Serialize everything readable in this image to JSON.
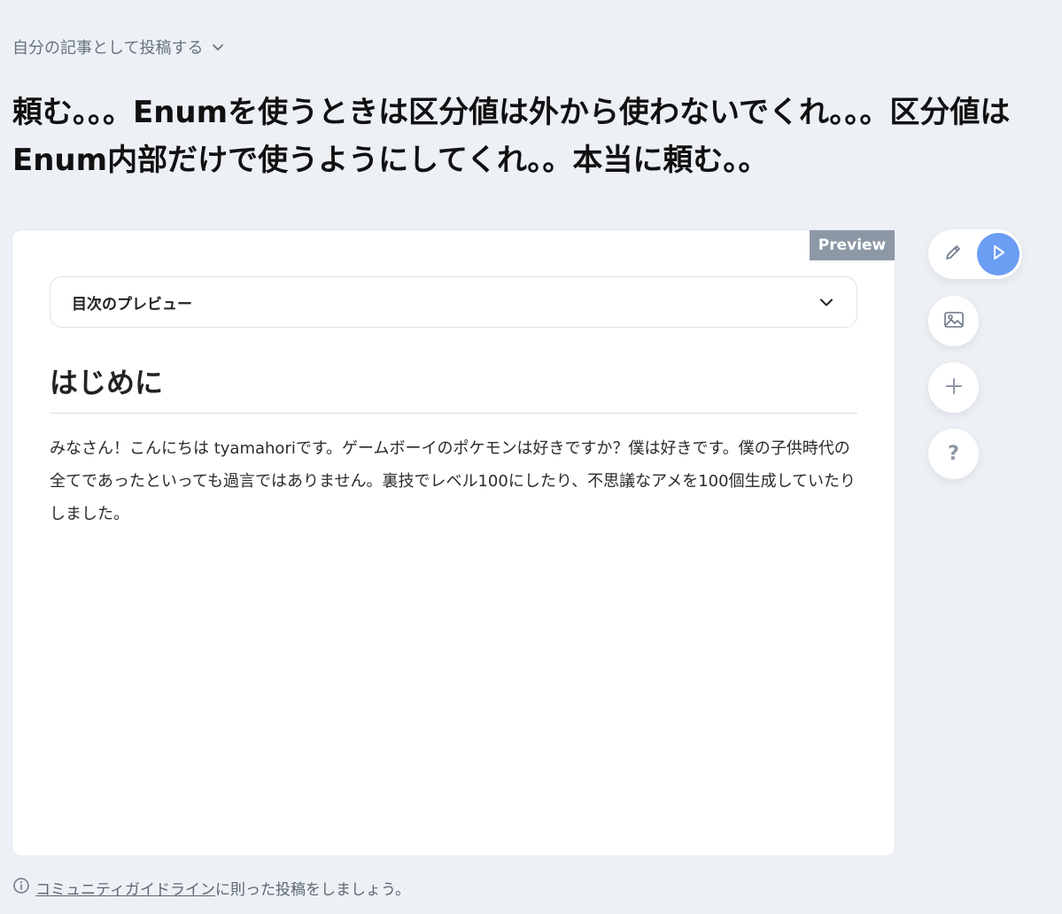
{
  "header": {
    "post_as_label": "自分の記事として投稿する"
  },
  "article": {
    "title": "頼む。。。Enumを使うときは区分値は外から使わないでくれ。。。区分値はEnum内部だけで使うようにしてくれ。。本当に頼む。。"
  },
  "editor": {
    "preview_badge": "Preview",
    "toc_label": "目次のプレビュー",
    "section_heading": "はじめに",
    "body_text": "みなさん！こんにちは tyamahoriです。ゲームボーイのポケモンは好きですか？僕は好きです。僕の子供時代の全てであったといっても過言ではありません。裏技でレベル100にしたり、不思議なアメを100個生成していたりしました。"
  },
  "side_tools": {
    "accent_color": "#6b9ef3",
    "icons": [
      "pencil-icon",
      "play-icon",
      "image-icon",
      "plus-icon",
      "help-icon"
    ],
    "help_label": "?"
  },
  "footer": {
    "guideline_link": "コミュニティガイドライン",
    "guideline_suffix": "に則った投稿をしましょう。"
  }
}
